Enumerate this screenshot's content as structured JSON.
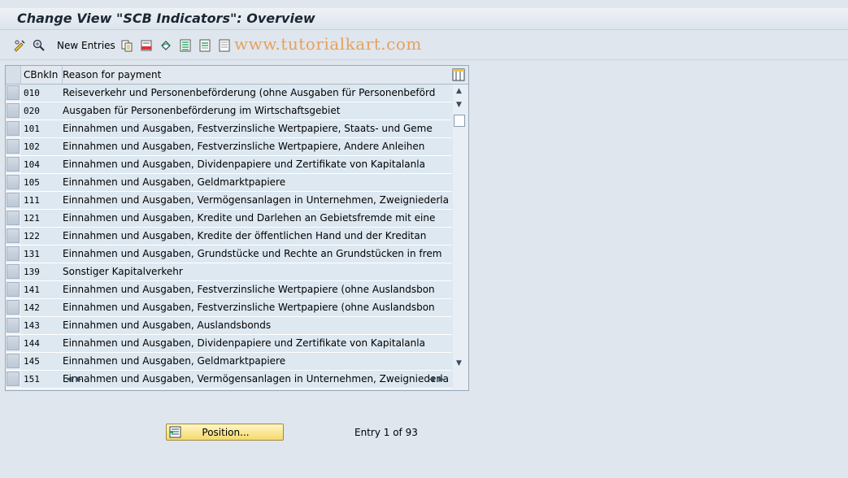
{
  "title": "Change View \"SCB Indicators\": Overview",
  "toolbar": {
    "new_entries_label": "New Entries",
    "watermark": "www.tutorialkart.com"
  },
  "table": {
    "headers": [
      "CBnkIn",
      "Reason for payment"
    ],
    "rows": [
      {
        "code": "010",
        "text": "Reiseverkehr und Personenbeförderung (ohne Ausgaben für Personenbeförd"
      },
      {
        "code": "020",
        "text": "Ausgaben für Personenbeförderung im Wirtschaftsgebiet"
      },
      {
        "code": "101",
        "text": "Einnahmen und Ausgaben, Festverzinsliche Wertpapiere, Staats- und Geme"
      },
      {
        "code": "102",
        "text": "Einnahmen und Ausgaben, Festverzinsliche Wertpapiere, Andere Anleihen"
      },
      {
        "code": "104",
        "text": "Einnahmen und Ausgaben, Dividenpapiere und Zertifikate von Kapitalanla"
      },
      {
        "code": "105",
        "text": "Einnahmen und Ausgaben, Geldmarktpapiere"
      },
      {
        "code": "111",
        "text": "Einnahmen und Ausgaben, Vermögensanlagen in Unternehmen, Zweigniederla"
      },
      {
        "code": "121",
        "text": "Einnahmen und Ausgaben, Kredite und Darlehen an Gebietsfremde mit eine"
      },
      {
        "code": "122",
        "text": "Einnahmen und Ausgaben, Kredite der öffentlichen Hand und der Kreditan"
      },
      {
        "code": "131",
        "text": "Einnahmen und Ausgaben, Grundstücke und Rechte an Grundstücken in frem"
      },
      {
        "code": "139",
        "text": "Sonstiger Kapitalverkehr"
      },
      {
        "code": "141",
        "text": "Einnahmen und Ausgaben, Festverzinsliche Wertpapiere (ohne Auslandsbon"
      },
      {
        "code": "142",
        "text": "Einnahmen und Ausgaben, Festverzinsliche Wertpapiere (ohne Auslandsbon"
      },
      {
        "code": "143",
        "text": "Einnahmen und Ausgaben, Auslandsbonds"
      },
      {
        "code": "144",
        "text": "Einnahmen und Ausgaben, Dividenpapiere und Zertifikate von Kapitalanla"
      },
      {
        "code": "145",
        "text": "Einnahmen und Ausgaben, Geldmarktpapiere"
      },
      {
        "code": "151",
        "text": "Einnahmen und Ausgaben, Vermögensanlagen in Unternehmen, Zweigniederla"
      }
    ]
  },
  "footer": {
    "position_label": "Position...",
    "entry_info": "Entry 1 of 93"
  },
  "colors": {
    "row_bg": "#dde8f1",
    "button_bg": "#f5d96a",
    "watermark": "#e8a15c"
  }
}
